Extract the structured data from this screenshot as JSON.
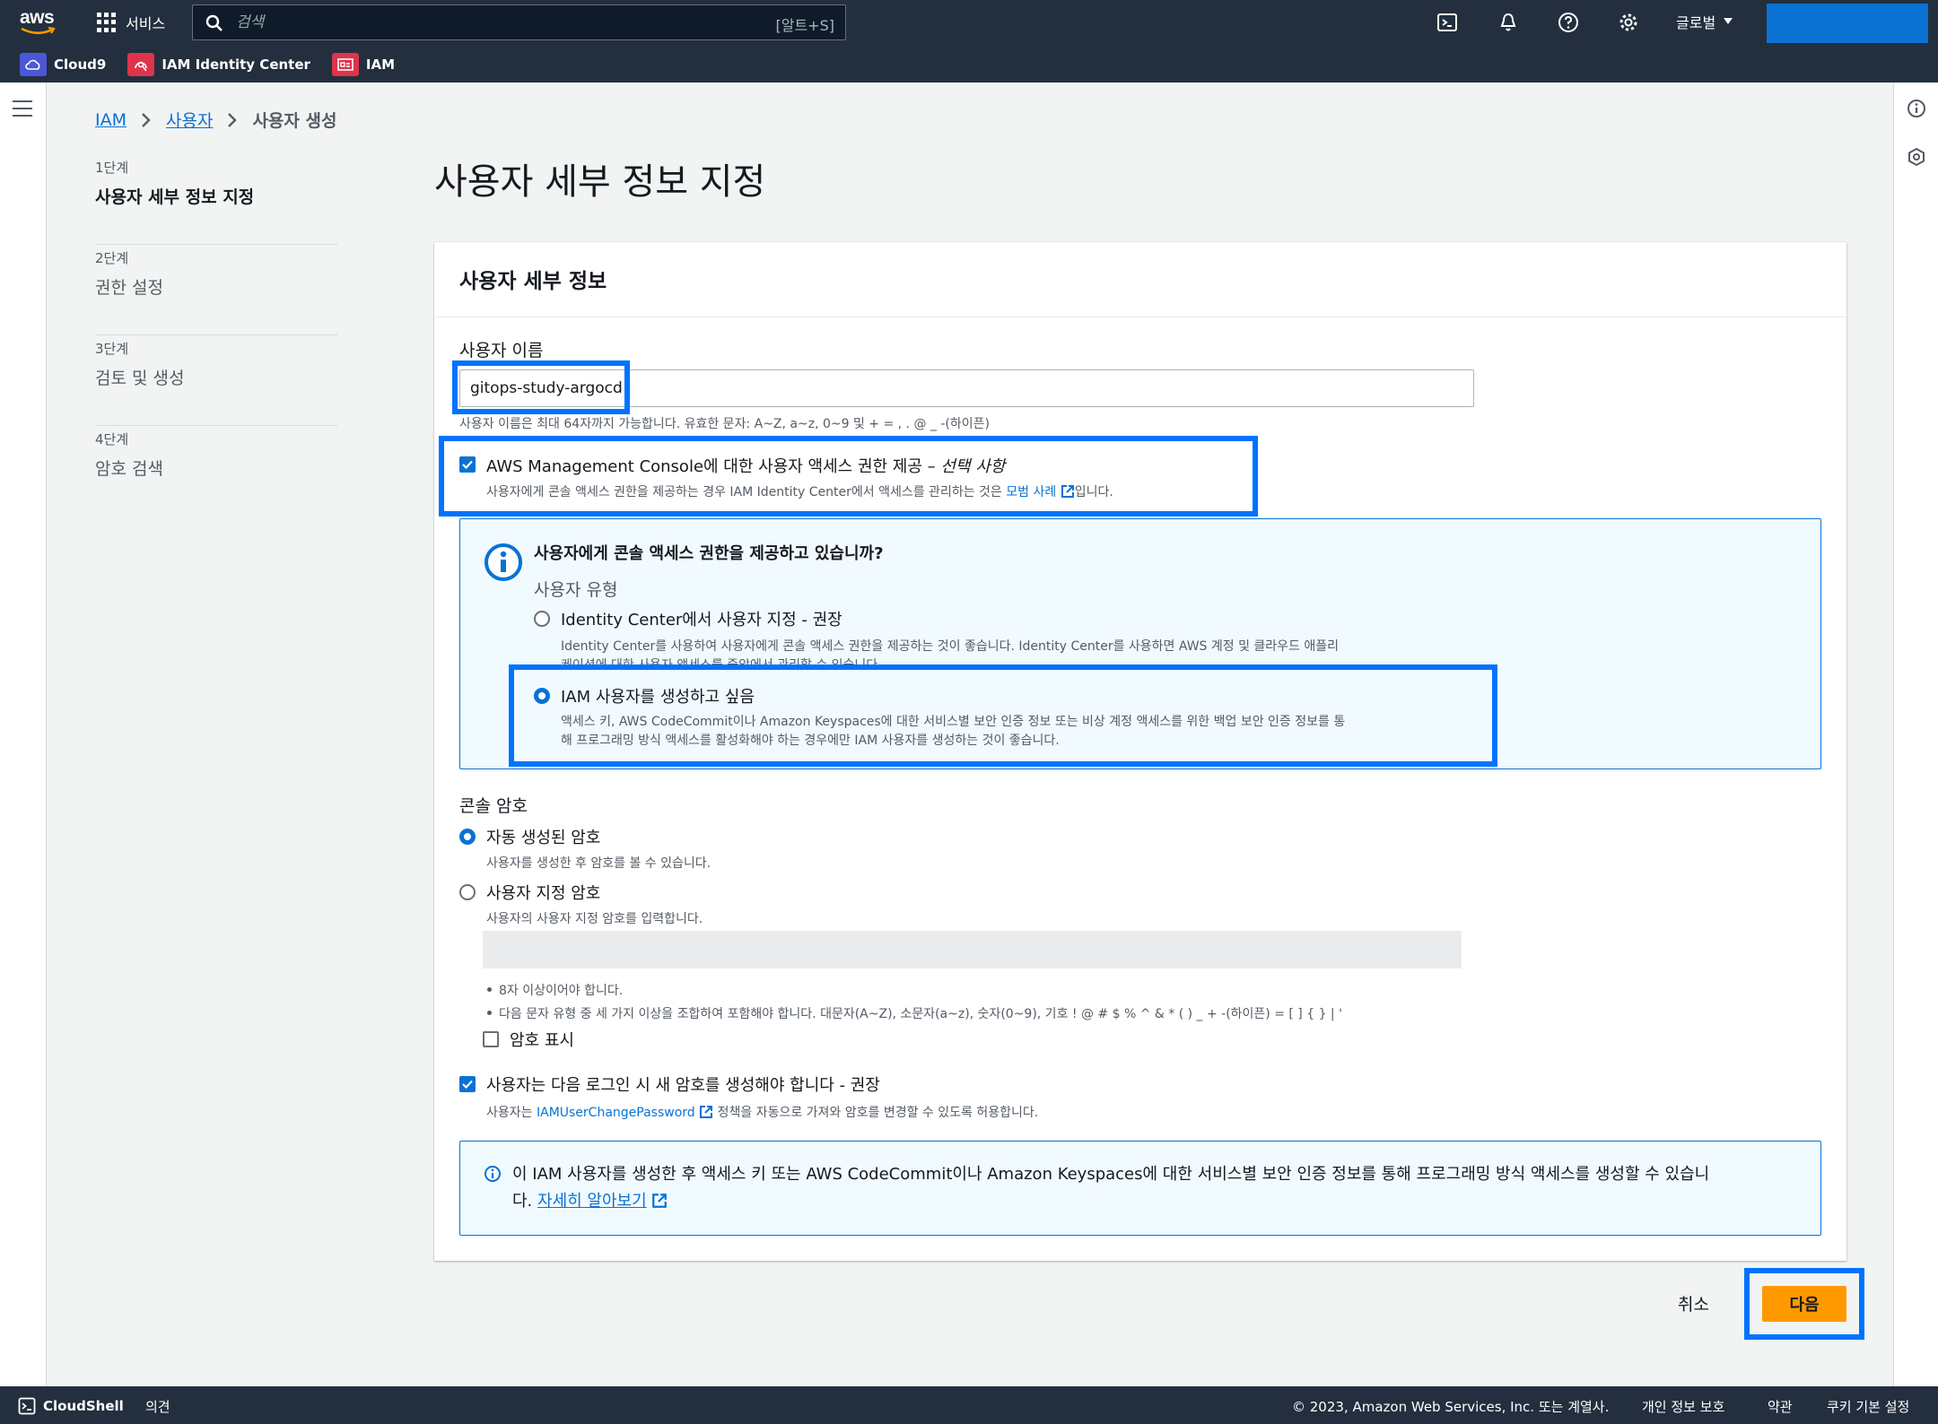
{
  "nav": {
    "logo": "aws",
    "services_label": "서비스",
    "search_placeholder": "검색",
    "search_shortcut": "[알트+S]",
    "region_label": "글로벌",
    "favorites": [
      {
        "label": "Cloud9",
        "icon": "cloud9-icon"
      },
      {
        "label": "IAM Identity Center",
        "icon": "identity-center-icon"
      },
      {
        "label": "IAM",
        "icon": "iam-icon"
      }
    ]
  },
  "breadcrumb": {
    "iam": "IAM",
    "users": "사용자",
    "current": "사용자 생성"
  },
  "steps": [
    {
      "num": "1단계",
      "label": "사용자 세부 정보 지정",
      "active": true
    },
    {
      "num": "2단계",
      "label": "권한 설정",
      "active": false
    },
    {
      "num": "3단계",
      "label": "검토 및 생성",
      "active": false
    },
    {
      "num": "4단계",
      "label": "암호 검색",
      "active": false
    }
  ],
  "page_title": "사용자 세부 정보 지정",
  "details": {
    "header": "사용자 세부 정보",
    "username_label": "사용자 이름",
    "username_value": "gitops-study-argocd",
    "username_hint": "사용자 이름은 최대 64자까지 가능합니다. 유효한 문자: A~Z, a~z, 0~9 및 + = , . @ _ -(하이픈)",
    "console_access_label": "AWS Management Console에 대한 사용자 액세스 권한 제공 –",
    "console_access_optional": "선택 사항",
    "console_access_hint_pre": "사용자에게 콘솔 액세스 권한을 제공하는 경우 IAM Identity Center에서 액세스를 관리하는 것은",
    "console_access_link": "모범 사례",
    "console_access_hint_post": "입니다."
  },
  "user_type_box": {
    "title": "사용자에게 콘솔 액세스 권한을 제공하고 있습니까?",
    "subtitle": "사용자 유형",
    "option1_label": "Identity Center에서 사용자 지정 - 권장",
    "option1_desc_line1": "Identity Center를 사용하여 사용자에게 콘솔 액세스 권한을 제공하는 것이 좋습니다. Identity Center를 사용하면 AWS 계정 및 클라우드 애플리",
    "option1_desc_line2": "케이션에 대한 사용자 액세스를 중앙에서 관리할 수 있습니다.",
    "option2_label": "IAM 사용자를 생성하고 싶음",
    "option2_desc_line1": "액세스 키, AWS CodeCommit이나 Amazon Keyspaces에 대한 서비스별 보안 인증 정보 또는 비상 계정 액세스를 위한 백업 보안 인증 정보를 통",
    "option2_desc_line2": "해 프로그래밍 방식 액세스를 활성화해야 하는 경우에만 IAM 사용자를 생성하는 것이 좋습니다."
  },
  "password": {
    "label": "콘솔 암호",
    "auto_label": "자동 생성된 암호",
    "auto_desc": "사용자를 생성한 후 암호를 볼 수 있습니다.",
    "custom_label": "사용자 지정 암호",
    "custom_desc": "사용자의 사용자 지정 암호를 입력합니다.",
    "rule1": "8자 이상이어야 합니다.",
    "rule2": "다음 문자 유형 중 세 가지 이상을 조합하여 포함해야 합니다. 대문자(A~Z), 소문자(a~z), 숫자(0~9), 기호 ! @ # $ % ^ & * ( ) _ + -(하이픈) = [ ] { } | '",
    "show_label": "암호 표시",
    "reset_label": "사용자는 다음 로그인 시 새 암호를 생성해야 합니다 - 권장",
    "reset_desc_pre": "사용자는",
    "reset_desc_link": "IAMUserChangePassword",
    "reset_desc_post": "정책을 자동으로 가져와 암호를 변경할 수 있도록 허용합니다."
  },
  "bottom_info": {
    "line1": "이 IAM 사용자를 생성한 후 액세스 키 또는 AWS CodeCommit이나 Amazon Keyspaces에 대한 서비스별 보안 인증 정보를 통해 프로그래밍 방식 액세스를 생성할 수 있습니",
    "line2_pre": "다.",
    "link": "자세히 알아보기"
  },
  "actions": {
    "cancel": "취소",
    "next": "다음"
  },
  "footer": {
    "cloudshell": "CloudShell",
    "feedback": "의견",
    "copyright": "© 2023, Amazon Web Services, Inc. 또는 계열사.",
    "privacy": "개인 정보 보호",
    "terms": "약관",
    "cookies": "쿠키 기본 설정"
  },
  "colors": {
    "nav_bg": "#232f3e",
    "accent": "#0972d3",
    "primary_button": "#ff9900",
    "highlight": "#0073ff"
  }
}
